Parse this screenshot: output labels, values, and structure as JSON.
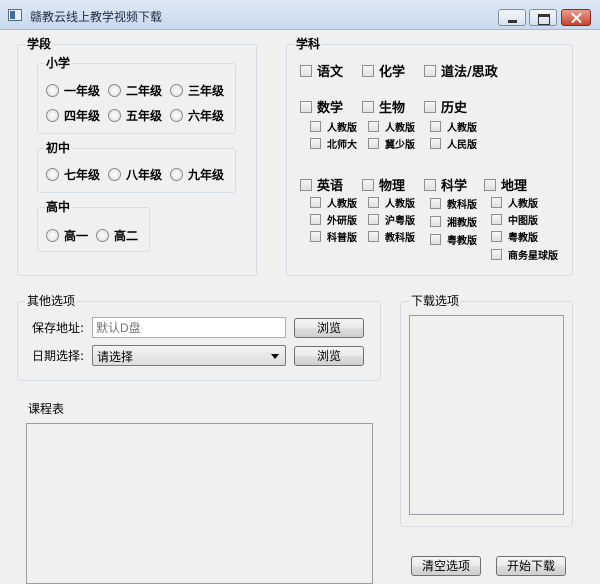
{
  "window": {
    "title": "赣教云线上教学视频下载"
  },
  "stage": {
    "label": "学段",
    "primary": {
      "label": "小学",
      "grades": [
        "一年级",
        "二年级",
        "三年级",
        "四年级",
        "五年级",
        "六年级"
      ]
    },
    "middle": {
      "label": "初中",
      "grades": [
        "七年级",
        "八年级",
        "九年级"
      ]
    },
    "high": {
      "label": "高中",
      "grades": [
        "高一",
        "高二"
      ]
    }
  },
  "subjects": {
    "label": "学科",
    "row1": [
      "语文",
      "化学",
      "道法/思政"
    ],
    "row2": [
      "数学",
      "生物",
      "历史"
    ],
    "row2_editions": [
      [
        "人教版",
        "北师大"
      ],
      [
        "人教版",
        "冀少版"
      ],
      [
        "人教版",
        "人民版"
      ]
    ],
    "row3": [
      "英语",
      "物理",
      "科学",
      "地理"
    ],
    "row3_editions": [
      [
        "人教版",
        "外研版",
        "科普版"
      ],
      [
        "人教版",
        "沪粤版",
        "教科版"
      ],
      [
        "教科版",
        "湘教版",
        "粤教版"
      ],
      [
        "人教版",
        "中图版",
        "粤教版",
        "商务星球版"
      ]
    ]
  },
  "other": {
    "label": "其他选项",
    "save_label": "保存地址:",
    "save_placeholder": "默认D盘",
    "browse_label": "浏览",
    "date_label": "日期选择:",
    "date_value": "请选择"
  },
  "schedule": {
    "label": "课程表"
  },
  "download": {
    "label": "下载选项"
  },
  "actions": {
    "clear": "清空选项",
    "start": "开始下载"
  }
}
